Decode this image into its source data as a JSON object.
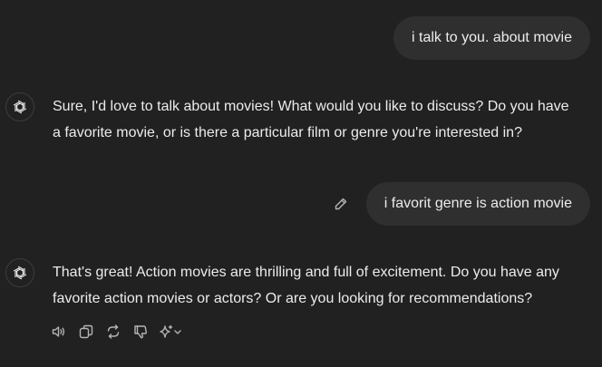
{
  "messages": [
    {
      "role": "user",
      "text": "i talk to you. about movie"
    },
    {
      "role": "assistant",
      "text": "Sure, I'd love to talk about movies! What would you like to discuss? Do you have a favorite movie, or is there a particular film or genre you're interested in?"
    },
    {
      "role": "user",
      "text": "i favorit genre is action movie"
    },
    {
      "role": "assistant",
      "text": "That's great! Action movies are thrilling and full of excitement. Do you have any favorite action movies or actors? Or are you looking for recommendations?"
    }
  ],
  "actions": {
    "icons": [
      "read-aloud-icon",
      "copy-icon",
      "regenerate-icon",
      "thumbs-down-icon",
      "sparkle-model-icon"
    ]
  },
  "colors": {
    "background": "#212121",
    "bubble": "#2f2f2f",
    "text": "#ececec",
    "icon": "#b4b4b4"
  }
}
